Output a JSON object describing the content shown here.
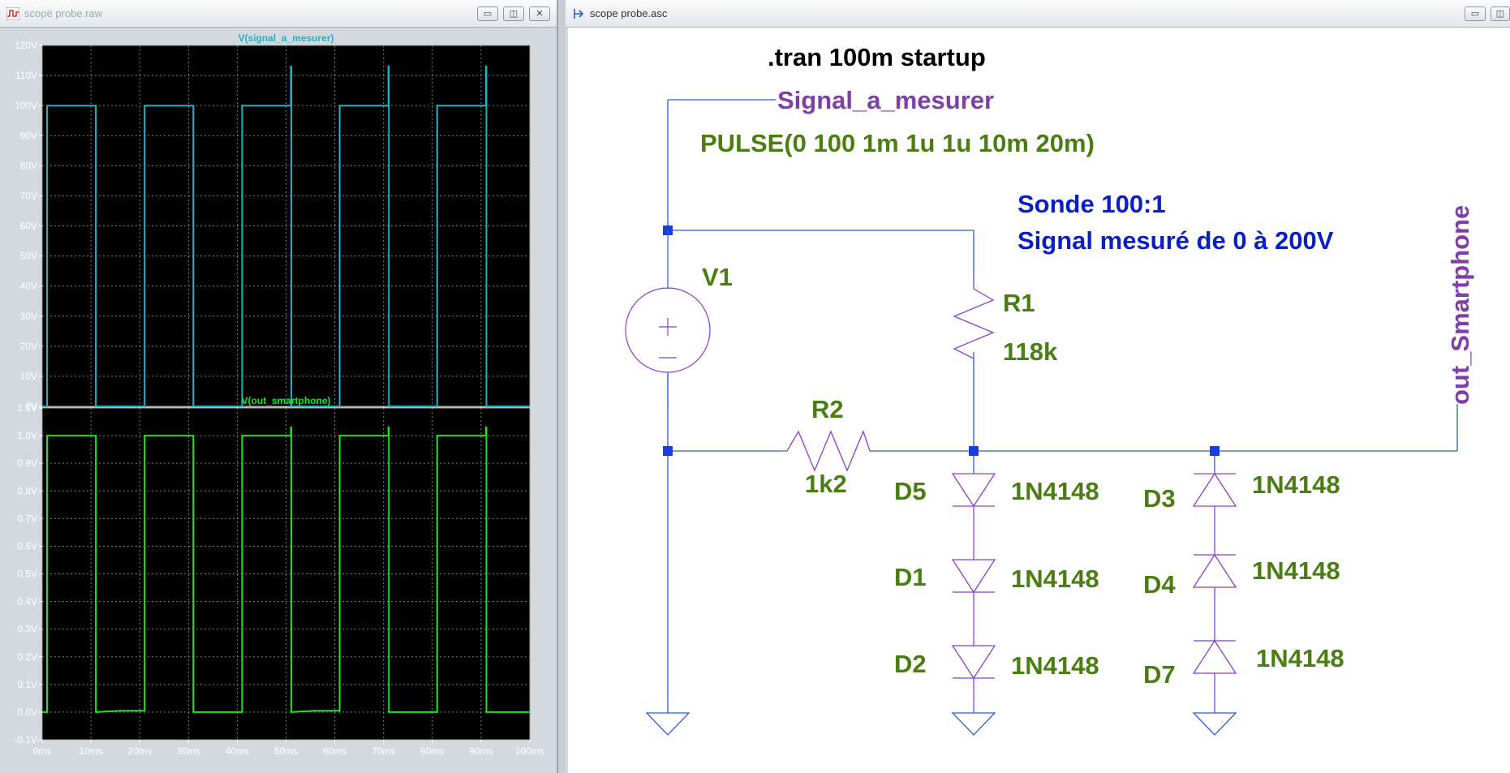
{
  "raw_window": {
    "title": "scope probe.raw",
    "icon": "waveform-icon"
  },
  "asc_window": {
    "title": "scope probe.asc",
    "icon": "schematic-icon"
  },
  "window_buttons": {
    "minimize": "▭",
    "restore": "◫",
    "close": "✕"
  },
  "colors": {
    "plot_bg": "#000000",
    "grid": "#808080",
    "trace_signal": "#1fb3c3",
    "trace_out": "#19e619",
    "wire": "#2a5fc8",
    "component": "#8a3fd0",
    "label_green": "#4a7d12",
    "label_blue": "#0a1ec8",
    "net_purple": "#7f3fa8"
  },
  "chart_data": [
    {
      "type": "line",
      "title": "V(signal_a_mesurer)",
      "x_ticks": [
        "0ms",
        "10ms",
        "20ms",
        "30ms",
        "40ms",
        "50ms",
        "60ms",
        "70ms",
        "80ms",
        "90ms",
        "100ms"
      ],
      "y_ticks": [
        "120V",
        "110V",
        "100V",
        "90V",
        "80V",
        "70V",
        "60V",
        "50V",
        "40V",
        "30V",
        "20V",
        "10V",
        "0V"
      ],
      "ylim": [
        0,
        120
      ],
      "xlim": [
        0,
        100
      ],
      "series": [
        {
          "name": "V(signal_a_mesurer)",
          "x": [
            0,
            1,
            1,
            11,
            11,
            21,
            21,
            31,
            31,
            41,
            41,
            51,
            51,
            51.1,
            51.1,
            61,
            61,
            71,
            71,
            71.1,
            71.1,
            81,
            81,
            91,
            91,
            91.1,
            91.1,
            100
          ],
          "y": [
            0,
            0,
            100,
            100,
            0,
            0,
            100,
            100,
            0,
            0,
            100,
            100,
            113,
            113,
            0,
            0,
            100,
            100,
            113,
            113,
            0,
            0,
            100,
            100,
            113,
            113,
            0,
            0
          ]
        }
      ]
    },
    {
      "type": "line",
      "title": "V(out_smartphone)",
      "x_ticks": [
        "0ms",
        "10ms",
        "20ms",
        "30ms",
        "40ms",
        "50ms",
        "60ms",
        "70ms",
        "80ms",
        "90ms",
        "100ms"
      ],
      "y_ticks": [
        "1.1V",
        "1.0V",
        "0.9V",
        "0.8V",
        "0.7V",
        "0.6V",
        "0.5V",
        "0.4V",
        "0.3V",
        "0.2V",
        "0.1V",
        "0.0V",
        "-0.1V"
      ],
      "ylim": [
        -0.1,
        1.1
      ],
      "xlim": [
        0,
        100
      ],
      "series": [
        {
          "name": "V(out_smartphone)",
          "x": [
            0,
            1,
            1,
            11,
            11,
            16,
            21,
            21,
            31,
            31,
            41,
            41,
            51,
            51,
            51.1,
            51.1,
            56,
            61,
            61,
            71,
            71,
            71.1,
            71.1,
            81,
            81,
            91,
            91,
            91.1,
            91.1,
            100
          ],
          "y": [
            0,
            0,
            1.0,
            1.0,
            0,
            0.005,
            0.005,
            1.0,
            1.0,
            0,
            0,
            1.0,
            1.0,
            1.03,
            1.03,
            0,
            0.005,
            0.005,
            1.0,
            1.0,
            1.03,
            1.03,
            0,
            0,
            1.0,
            1.0,
            1.03,
            1.03,
            0,
            0
          ]
        }
      ]
    }
  ],
  "schematic": {
    "directive": ".tran 100m startup",
    "net_signal": "Signal_a_mesurer",
    "source_value": "PULSE(0 100 1m 1u 1u 10m 20m)",
    "note_line1": "Sonde 100:1",
    "note_line2": "Signal mesuré de 0 à 200V",
    "source_name": "V1",
    "r1_name": "R1",
    "r1_value": "118k",
    "r2_name": "R2",
    "r2_value": "1k2",
    "net_out": "out_Smartphone",
    "diodes_left": [
      {
        "name": "D5",
        "value": "1N4148"
      },
      {
        "name": "D1",
        "value": "1N4148"
      },
      {
        "name": "D2",
        "value": "1N4148"
      }
    ],
    "diodes_right": [
      {
        "name": "D3",
        "value": "1N4148"
      },
      {
        "name": "D4",
        "value": "1N4148"
      },
      {
        "name": "D7",
        "value": "1N4148"
      }
    ]
  }
}
